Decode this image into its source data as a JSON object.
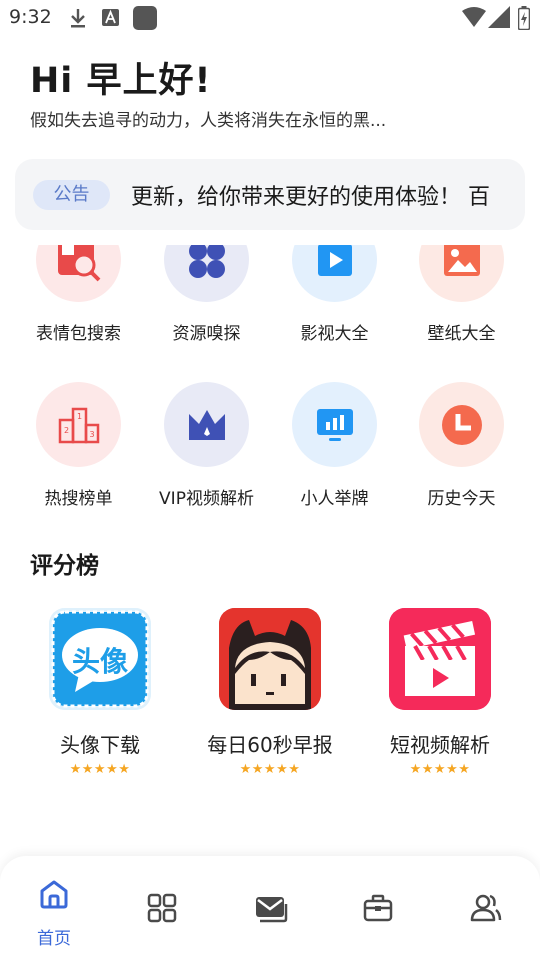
{
  "status_bar": {
    "time": "9:32"
  },
  "greeting": {
    "title": "Hi 早上好!",
    "subtitle": "假如失去追寻的动力，人类将消失在永恒的黑..."
  },
  "notice": {
    "badge": "公告",
    "text": "更新，给你带来更好的使用体验！ 百"
  },
  "tools": [
    {
      "label": "表情包搜索",
      "icon": "image-search-icon",
      "bg": "#fde8e8",
      "color": "#e84a4a"
    },
    {
      "label": "资源嗅探",
      "icon": "four-petal-icon",
      "bg": "#e8eaf6",
      "color": "#3f51b5"
    },
    {
      "label": "影视大全",
      "icon": "video-play-icon",
      "bg": "#e3f0fd",
      "color": "#2196f3"
    },
    {
      "label": "壁纸大全",
      "icon": "picture-icon",
      "bg": "#fde9e4",
      "color": "#f46a4e"
    },
    {
      "label": "热搜榜单",
      "icon": "podium-icon",
      "bg": "#fde8e8",
      "color": "#e84a4a"
    },
    {
      "label": "VIP视频解析",
      "icon": "crown-icon",
      "bg": "#e8eaf6",
      "color": "#3f51b5"
    },
    {
      "label": "小人举牌",
      "icon": "monitor-chart-icon",
      "bg": "#e3f0fd",
      "color": "#2196f3"
    },
    {
      "label": "历史今天",
      "icon": "clock-icon",
      "bg": "#fde9e4",
      "color": "#f46a4e"
    }
  ],
  "ranking": {
    "title": "评分榜",
    "items": [
      {
        "name": "头像下载",
        "stars": "★★★★★",
        "icon": "avatar-download-icon",
        "icon_text": "头像"
      },
      {
        "name": "每日60秒早报",
        "stars": "★★★★★",
        "icon": "cartoon-girl-icon"
      },
      {
        "name": "短视频解析",
        "stars": "★★★★★",
        "icon": "clapperboard-icon"
      }
    ]
  },
  "bottom_nav": {
    "active_color": "#3b69d8",
    "inactive_color": "#4a4a4a",
    "items": [
      {
        "label": "首页",
        "icon": "home-icon",
        "active": true
      },
      {
        "label": "",
        "icon": "grid-apps-icon",
        "active": false
      },
      {
        "label": "",
        "icon": "mail-icon",
        "active": false
      },
      {
        "label": "",
        "icon": "toolbox-icon",
        "active": false
      },
      {
        "label": "",
        "icon": "users-icon",
        "active": false
      }
    ]
  }
}
